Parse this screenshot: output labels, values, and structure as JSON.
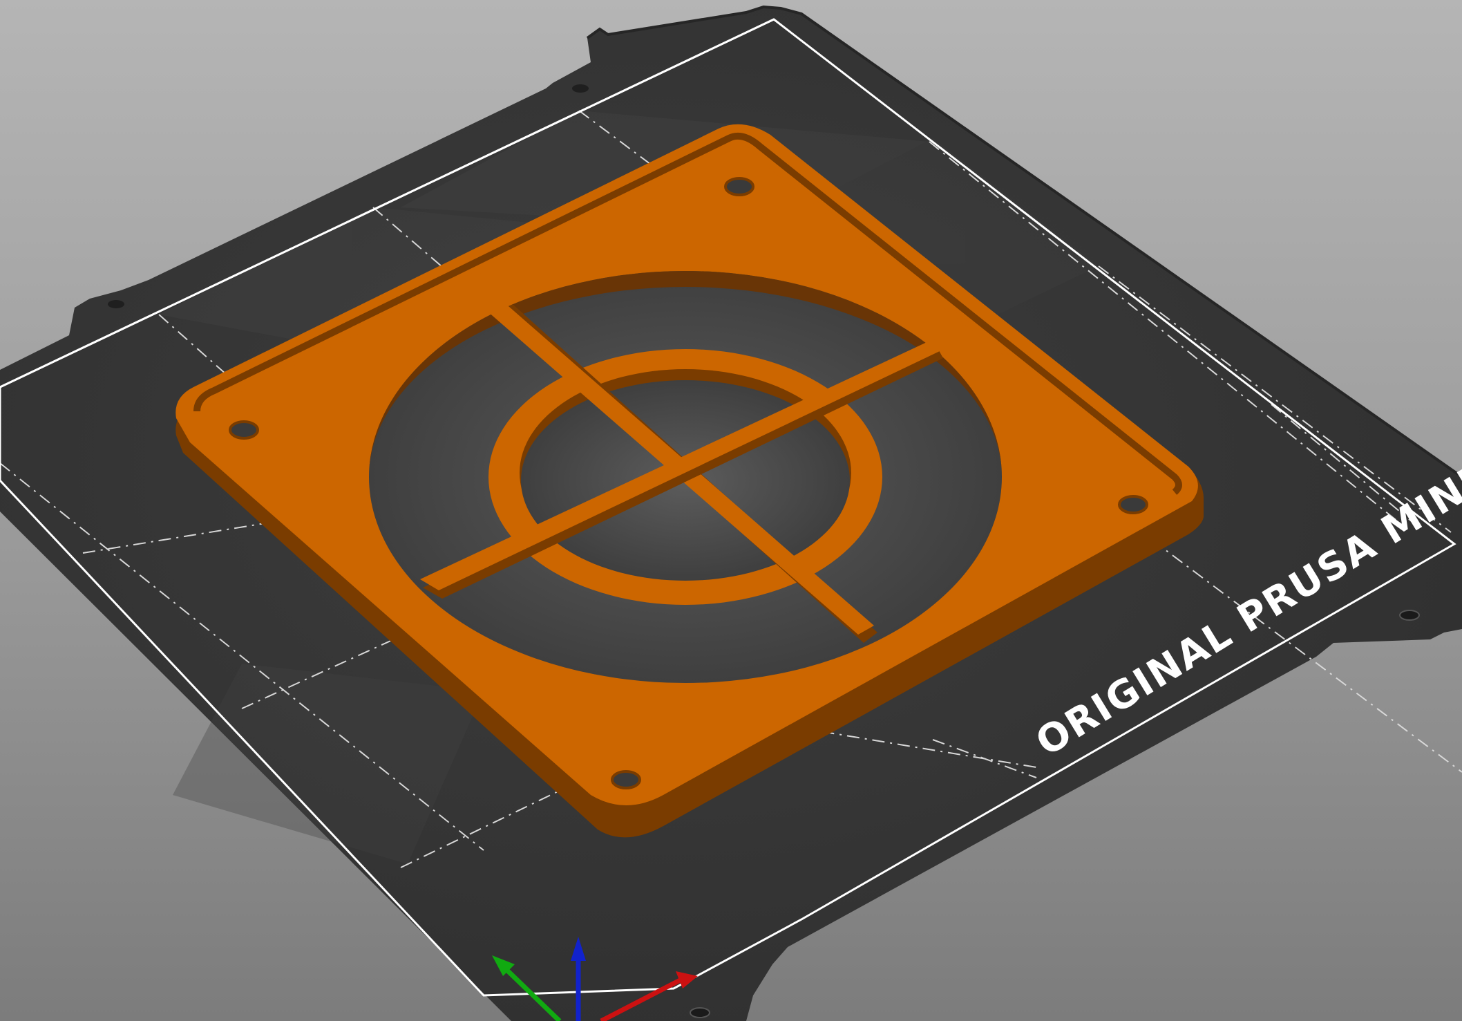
{
  "viewport": {
    "bed_label": "ORIGINAL PRUSA MINI",
    "colors": {
      "background_top": "#b5b5b5",
      "background_bottom": "#7c7c7c",
      "bed_sheet": "#343434",
      "bed_grid_cell": "#3a3a3a",
      "bed_outline": "#ffffff",
      "model_top": "#cc6600",
      "model_side": "#7a3c00",
      "axis_x": "#cc1111",
      "axis_y": "#11aa11",
      "axis_z": "#1122cc"
    },
    "model": {
      "name": "fan-grill-guard",
      "color_name": "orange"
    },
    "axes": [
      "x-axis",
      "y-axis",
      "z-axis"
    ]
  }
}
